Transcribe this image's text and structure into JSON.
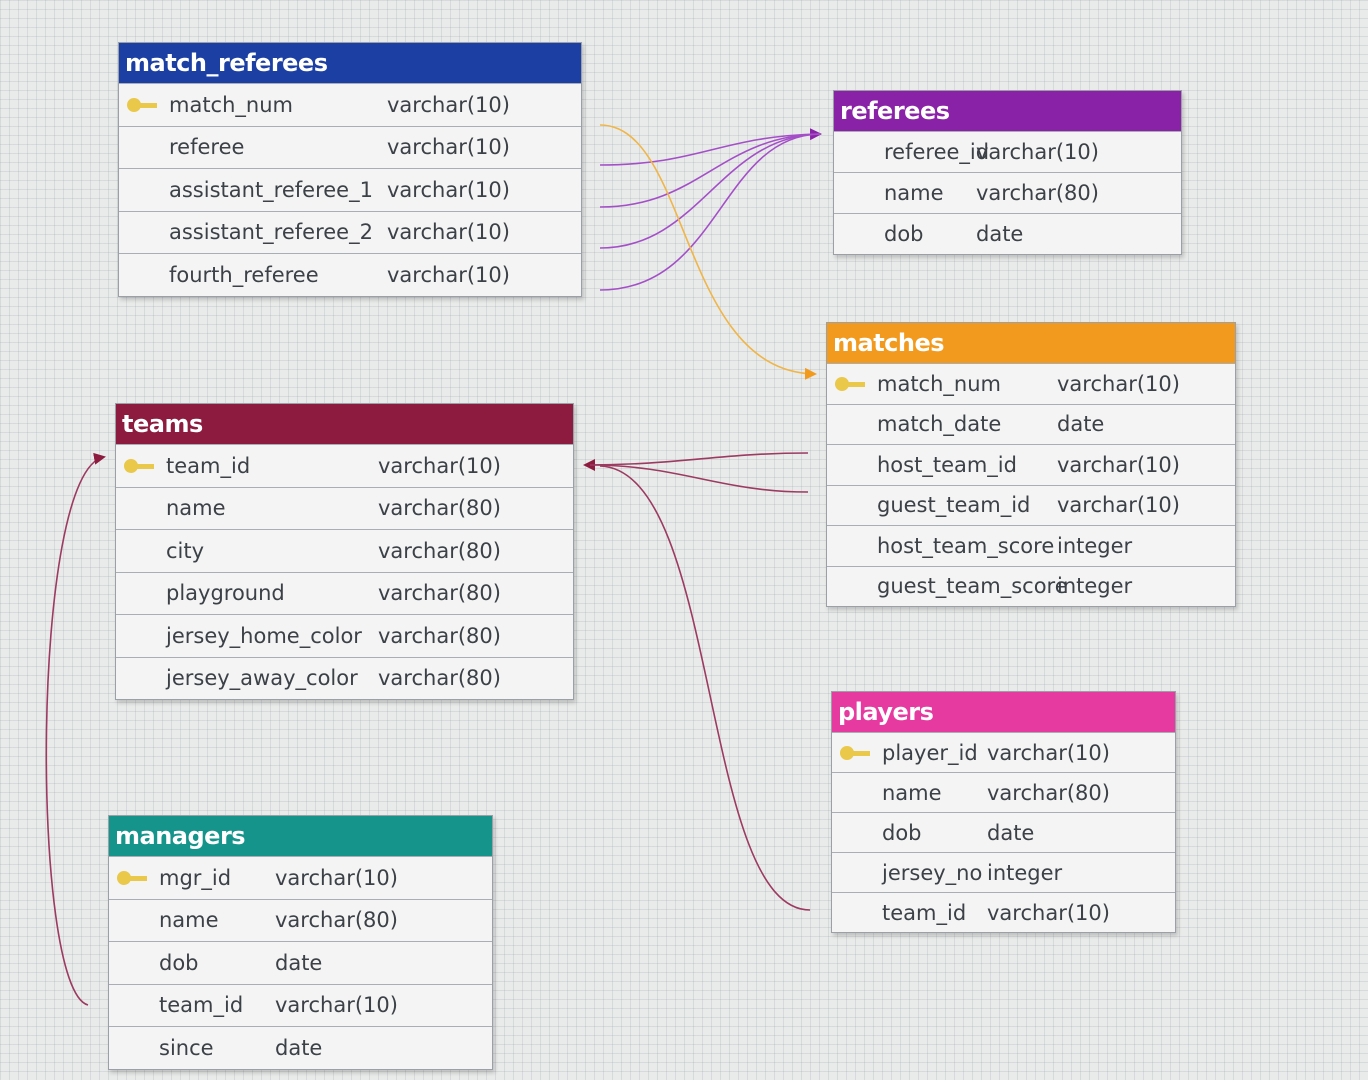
{
  "tables": {
    "match_referees": {
      "title": "match_referees",
      "color": "#1b3fa3",
      "columns": [
        {
          "name": "match_num",
          "type": "varchar(10)",
          "key": true
        },
        {
          "name": "referee",
          "type": "varchar(10)",
          "key": false
        },
        {
          "name": "assistant_referee_1",
          "type": "varchar(10)",
          "key": false
        },
        {
          "name": "assistant_referee_2",
          "type": "varchar(10)",
          "key": false
        },
        {
          "name": "fourth_referee",
          "type": "varchar(10)",
          "key": false
        }
      ]
    },
    "referees": {
      "title": "referees",
      "color": "#8a22a8",
      "columns": [
        {
          "name": "referee_id",
          "type": "varchar(10)",
          "key": false
        },
        {
          "name": "name",
          "type": "varchar(80)",
          "key": false
        },
        {
          "name": "dob",
          "type": "date",
          "key": false
        }
      ]
    },
    "matches": {
      "title": "matches",
      "color": "#f29a1d",
      "columns": [
        {
          "name": "match_num",
          "type": "varchar(10)",
          "key": true
        },
        {
          "name": "match_date",
          "type": "date",
          "key": false
        },
        {
          "name": "host_team_id",
          "type": "varchar(10)",
          "key": false
        },
        {
          "name": "guest_team_id",
          "type": "varchar(10)",
          "key": false
        },
        {
          "name": "host_team_score",
          "type": "integer",
          "key": false
        },
        {
          "name": "guest_team_score",
          "type": "integer",
          "key": false
        }
      ]
    },
    "teams": {
      "title": "teams",
      "color": "#8d1a3f",
      "columns": [
        {
          "name": "team_id",
          "type": "varchar(10)",
          "key": true
        },
        {
          "name": "name",
          "type": "varchar(80)",
          "key": false
        },
        {
          "name": "city",
          "type": "varchar(80)",
          "key": false
        },
        {
          "name": "playground",
          "type": "varchar(80)",
          "key": false
        },
        {
          "name": "jersey_home_color",
          "type": "varchar(80)",
          "key": false
        },
        {
          "name": "jersey_away_color",
          "type": "varchar(80)",
          "key": false
        }
      ]
    },
    "players": {
      "title": "players",
      "color": "#e63aa0",
      "columns": [
        {
          "name": "player_id",
          "type": "varchar(10)",
          "key": true
        },
        {
          "name": "name",
          "type": "varchar(80)",
          "key": false
        },
        {
          "name": "dob",
          "type": "date",
          "key": false
        },
        {
          "name": "jersey_no",
          "type": "integer",
          "key": false
        },
        {
          "name": "team_id",
          "type": "varchar(10)",
          "key": false
        }
      ]
    },
    "managers": {
      "title": "managers",
      "color": "#14948a",
      "columns": [
        {
          "name": "mgr_id",
          "type": "varchar(10)",
          "key": true
        },
        {
          "name": "name",
          "type": "varchar(80)",
          "key": false
        },
        {
          "name": "dob",
          "type": "date",
          "key": false
        },
        {
          "name": "team_id",
          "type": "varchar(10)",
          "key": false
        },
        {
          "name": "since",
          "type": "date",
          "key": false
        }
      ]
    }
  },
  "relationships": [
    {
      "from": "match_referees.referee",
      "to": "referees.referee_id",
      "color": "#a44fc8"
    },
    {
      "from": "match_referees.assistant_referee_1",
      "to": "referees.referee_id",
      "color": "#a44fc8"
    },
    {
      "from": "match_referees.assistant_referee_2",
      "to": "referees.referee_id",
      "color": "#a44fc8"
    },
    {
      "from": "match_referees.fourth_referee",
      "to": "referees.referee_id",
      "color": "#a44fc8"
    },
    {
      "from": "match_referees.match_num",
      "to": "matches.match_num",
      "color": "#f0b548"
    },
    {
      "from": "matches.host_team_id",
      "to": "teams.team_id",
      "color": "#9c3a60"
    },
    {
      "from": "matches.guest_team_id",
      "to": "teams.team_id",
      "color": "#9c3a60"
    },
    {
      "from": "players.team_id",
      "to": "teams.team_id",
      "color": "#9c3a60"
    },
    {
      "from": "managers.team_id",
      "to": "teams.team_id",
      "color": "#9c3a60"
    }
  ]
}
